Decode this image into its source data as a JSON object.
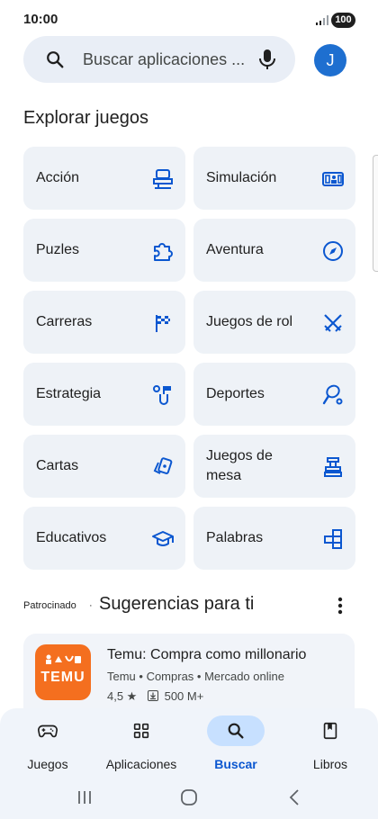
{
  "status": {
    "time": "10:00",
    "battery": "100"
  },
  "search": {
    "placeholder": "Buscar aplicaciones ..."
  },
  "account": {
    "avatar_letter": "J"
  },
  "explore": {
    "title": "Explorar juegos",
    "categories": [
      {
        "label": "Acción",
        "icon": "action-icon"
      },
      {
        "label": "Simulación",
        "icon": "simulation-icon"
      },
      {
        "label": "Puzles",
        "icon": "puzzle-icon"
      },
      {
        "label": "Aventura",
        "icon": "compass-icon"
      },
      {
        "label": "Carreras",
        "icon": "checkered-flag-icon"
      },
      {
        "label": "Juegos de rol",
        "icon": "crossed-swords-icon"
      },
      {
        "label": "Estrategia",
        "icon": "strategy-icon"
      },
      {
        "label": "Deportes",
        "icon": "sports-icon"
      },
      {
        "label": "Cartas",
        "icon": "cards-icon"
      },
      {
        "label": "Juegos de mesa",
        "icon": "board-game-icon"
      },
      {
        "label": "Educativos",
        "icon": "graduation-cap-icon"
      },
      {
        "label": "Palabras",
        "icon": "word-blocks-icon"
      }
    ]
  },
  "suggestions": {
    "sponsored_label": "Patrocinado",
    "separator": "·",
    "title": "Sugerencias para ti",
    "app": {
      "logo_text": "TEMU",
      "name": "Temu: Compra como millonario",
      "meta": "Temu • Compras • Mercado online",
      "rating": "4,5 ★",
      "downloads": "500 M+"
    }
  },
  "bottom_nav": [
    {
      "label": "Juegos",
      "icon": "gamepad-icon",
      "active": false
    },
    {
      "label": "Aplicaciones",
      "icon": "apps-grid-icon",
      "active": false
    },
    {
      "label": "Buscar",
      "icon": "search-icon",
      "active": true
    },
    {
      "label": "Libros",
      "icon": "book-icon",
      "active": false
    }
  ],
  "colors": {
    "accent": "#0b57d0",
    "tile_bg": "#eef2f7",
    "active_pill": "#c7e0ff",
    "brand_temu": "#f46f1f"
  }
}
